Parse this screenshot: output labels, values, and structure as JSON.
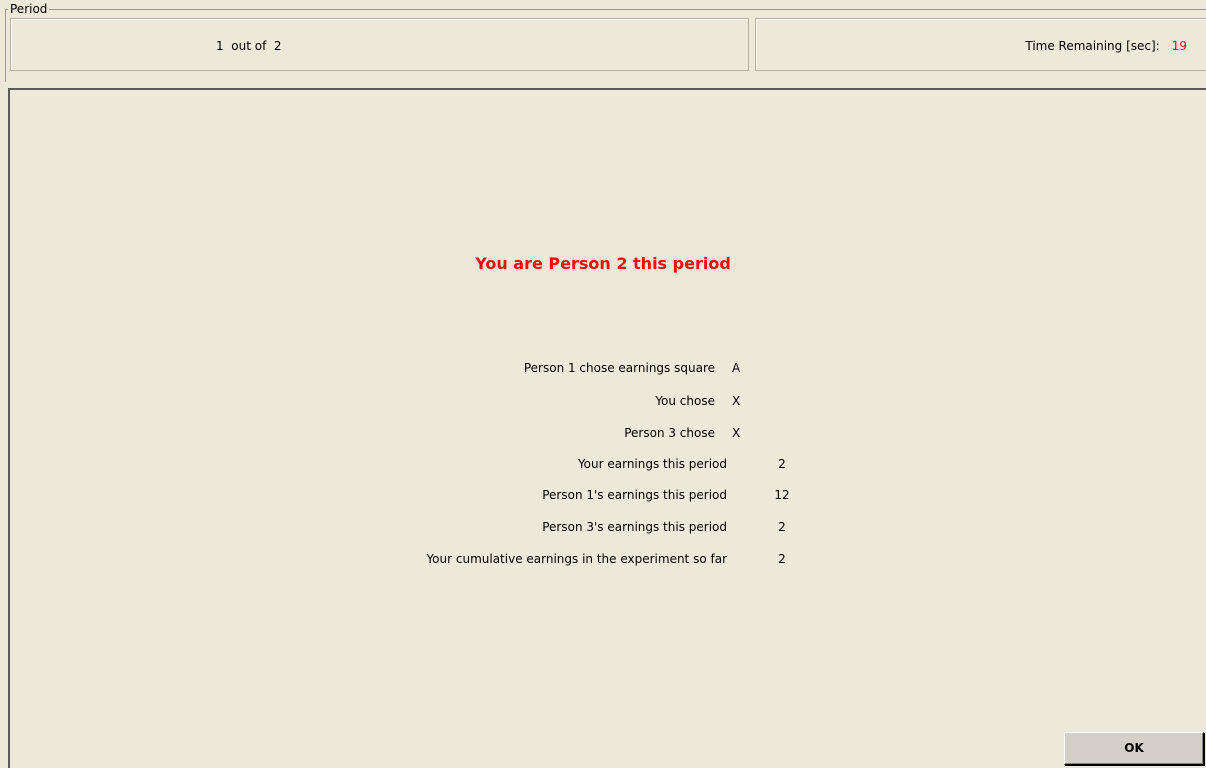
{
  "period": {
    "legend": "Period",
    "value": "1  out of  2"
  },
  "timer": {
    "label": "Time Remaining [sec]:",
    "value": "19"
  },
  "main": {
    "headline": "You are Person 2 this period",
    "rows": [
      {
        "label": "Person 1 chose earnings square",
        "choice": "A",
        "value": ""
      },
      {
        "label": "You chose",
        "choice": "X",
        "value": ""
      },
      {
        "label": "Person 3 chose",
        "choice": "X",
        "value": ""
      },
      {
        "label": "Your earnings this period",
        "choice": "",
        "value": "2"
      },
      {
        "label": "Person 1's earnings this period",
        "choice": "",
        "value": "12"
      },
      {
        "label": "Person 3's earnings this period",
        "choice": "",
        "value": "2"
      },
      {
        "label": "Your cumulative earnings in the experiment so far",
        "choice": "",
        "value": "2"
      }
    ],
    "ok_label": "OK"
  },
  "colors": {
    "background": "#ece9d8",
    "alert_text": "#ff0000"
  }
}
